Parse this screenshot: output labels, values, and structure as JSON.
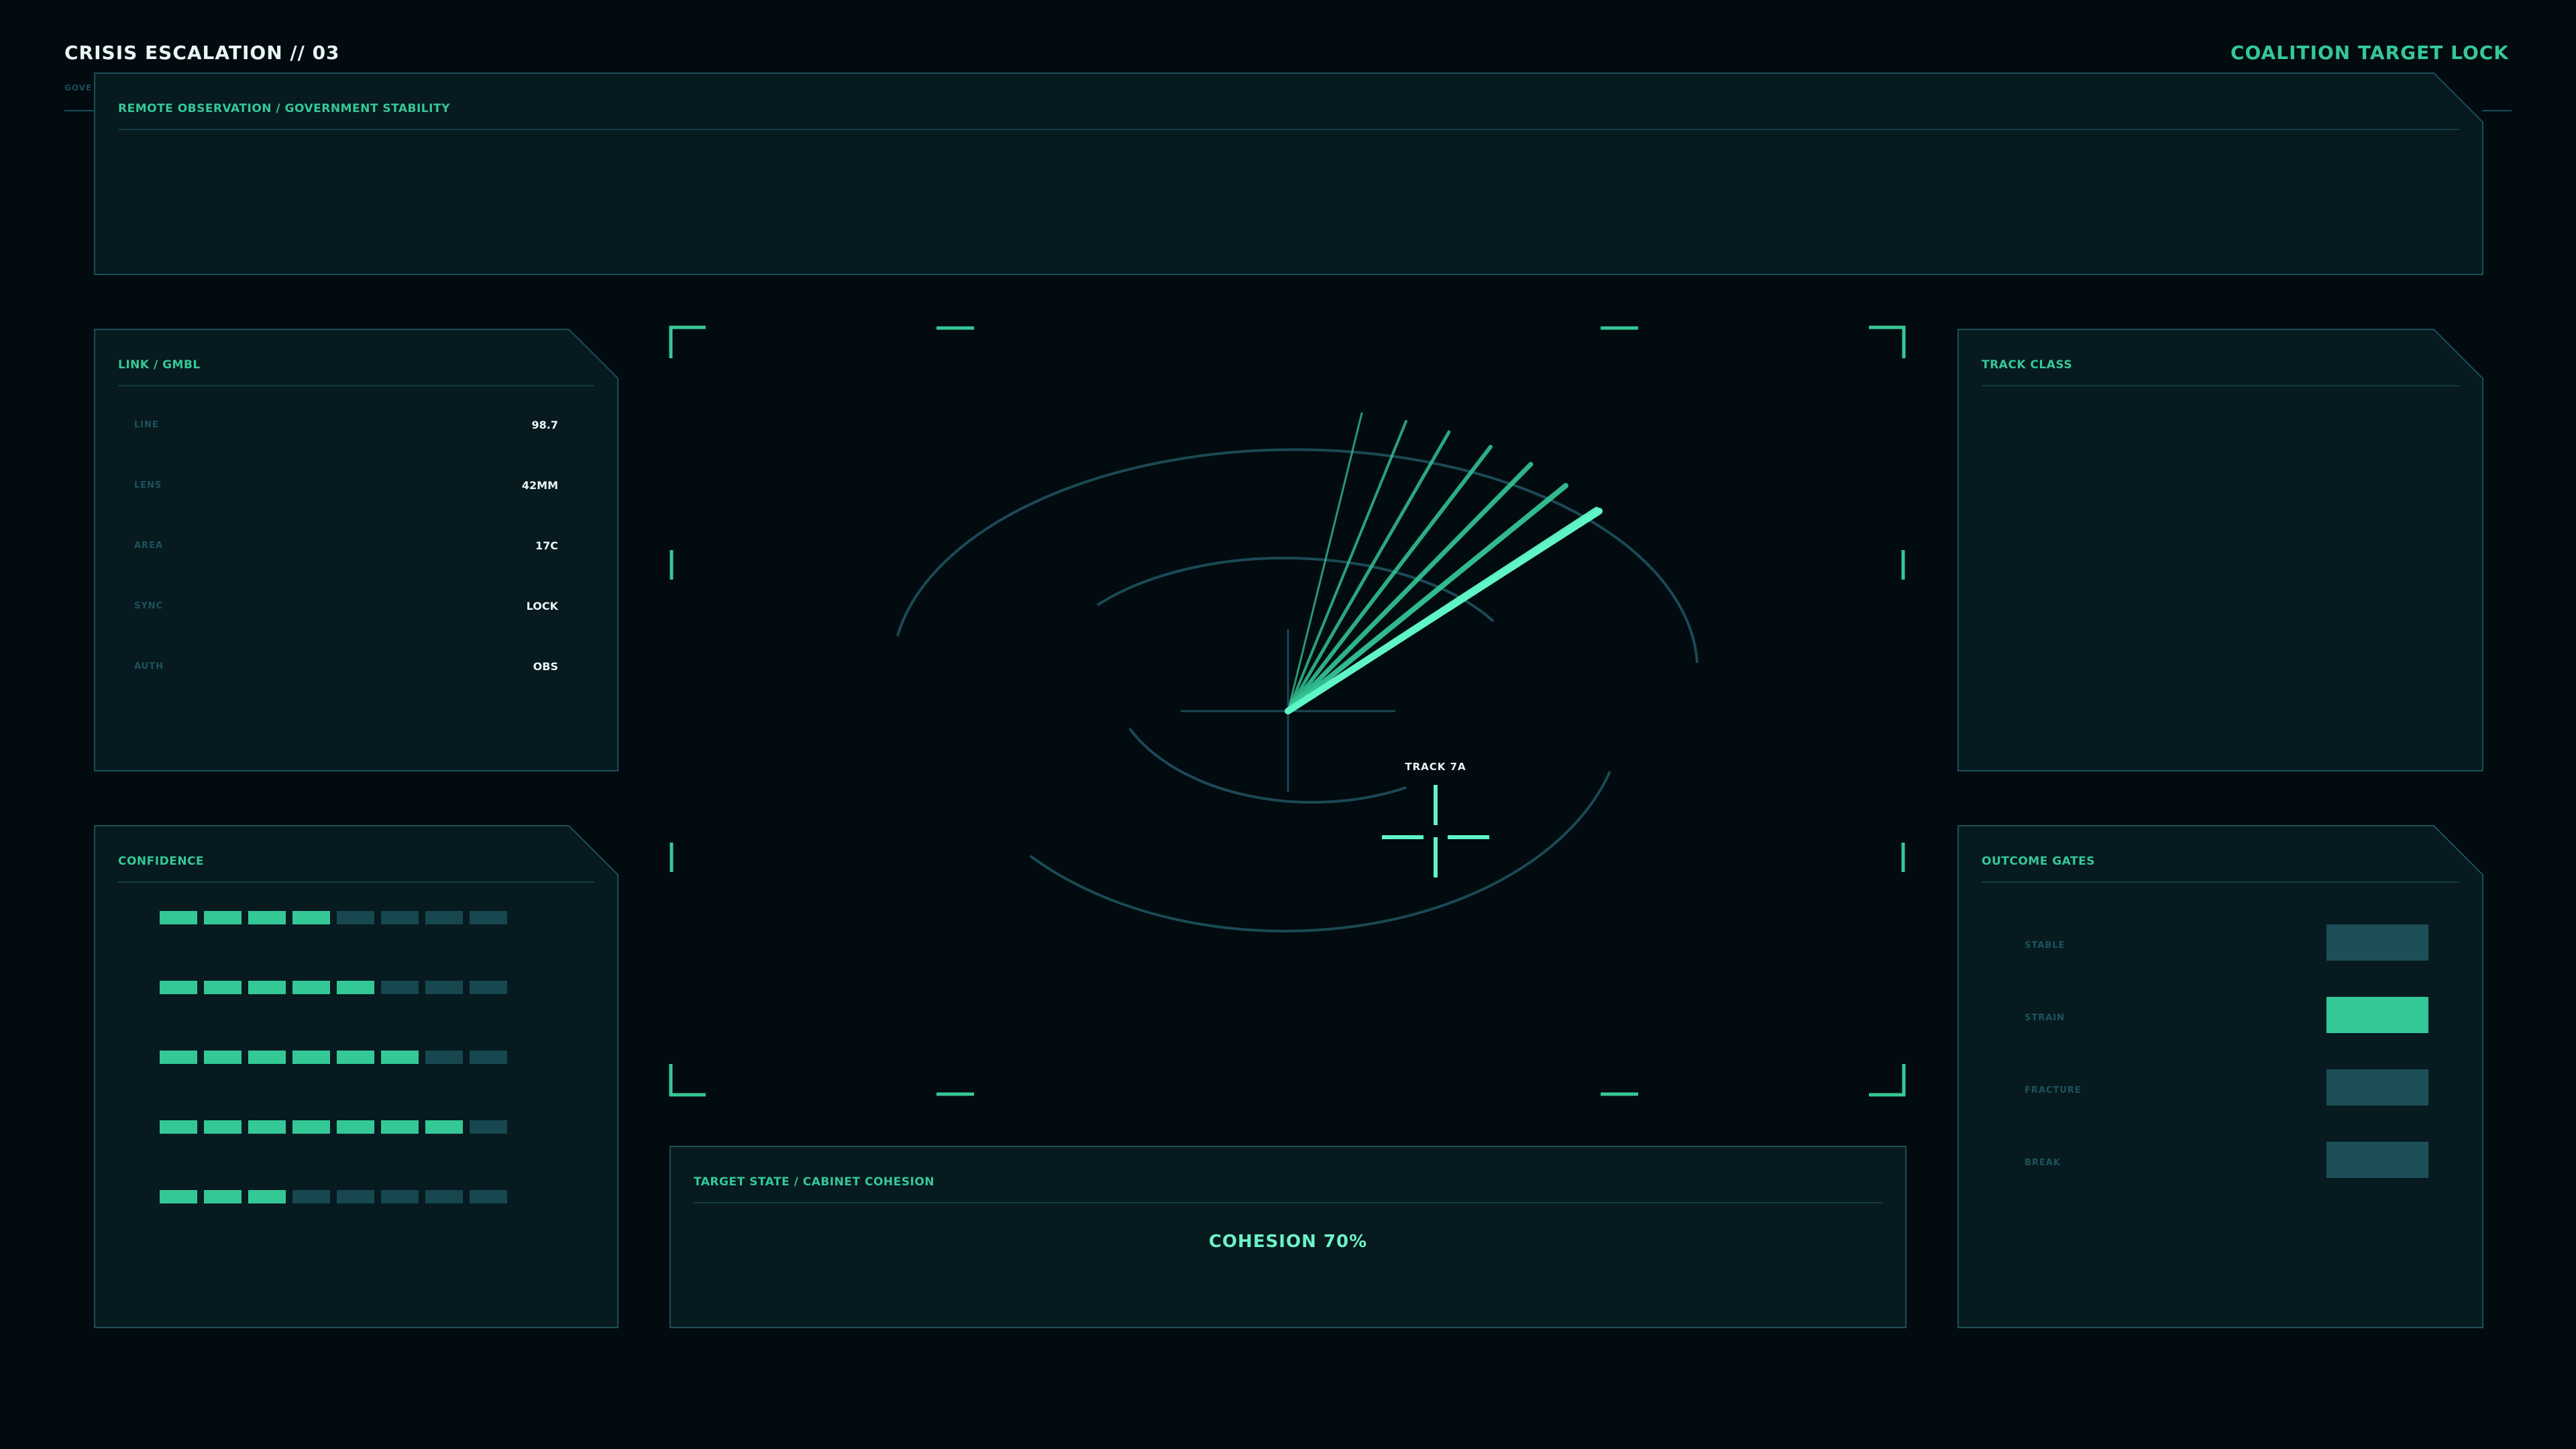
{
  "header": {
    "title": "CRISIS ESCALATION // 03",
    "subtitle": "GOVE",
    "right_label": "COALITION TARGET LOCK"
  },
  "remote_panel": {
    "title": "REMOTE OBSERVATION / GOVERNMENT STABILITY"
  },
  "link_panel": {
    "title": "LINK / GMBL",
    "rows": [
      {
        "key": "LINE",
        "value": "98.7"
      },
      {
        "key": "LENS",
        "value": "42MM"
      },
      {
        "key": "AREA",
        "value": "17C"
      },
      {
        "key": "SYNC",
        "value": "LOCK"
      },
      {
        "key": "AUTH",
        "value": "OBS"
      }
    ]
  },
  "confidence_panel": {
    "title": "CONFIDENCE",
    "segments_total": 8,
    "rows": [
      4,
      5,
      6,
      7,
      3
    ]
  },
  "track_panel": {
    "title": "TRACK CLASS"
  },
  "gates_panel": {
    "title": "OUTCOME GATES",
    "gates": [
      {
        "label": "STABLE",
        "active": false
      },
      {
        "label": "STRAIN",
        "active": true
      },
      {
        "label": "FRACTURE",
        "active": false
      },
      {
        "label": "BREAK",
        "active": false
      }
    ]
  },
  "target_panel": {
    "title": "TARGET STATE / CABINET COHESION",
    "cohesion_label": "COHESION 70%",
    "cohesion_value": 70
  },
  "scope": {
    "track_label": "TRACK 7A",
    "sweep_lines": 8
  },
  "colors": {
    "accent": "#35c897",
    "accent_bright": "#5ff5c6",
    "panel_bg": "#061a20",
    "panel_border": "#1c4f58",
    "segment_off": "#17474f",
    "gate_off": "#1c4f58"
  }
}
